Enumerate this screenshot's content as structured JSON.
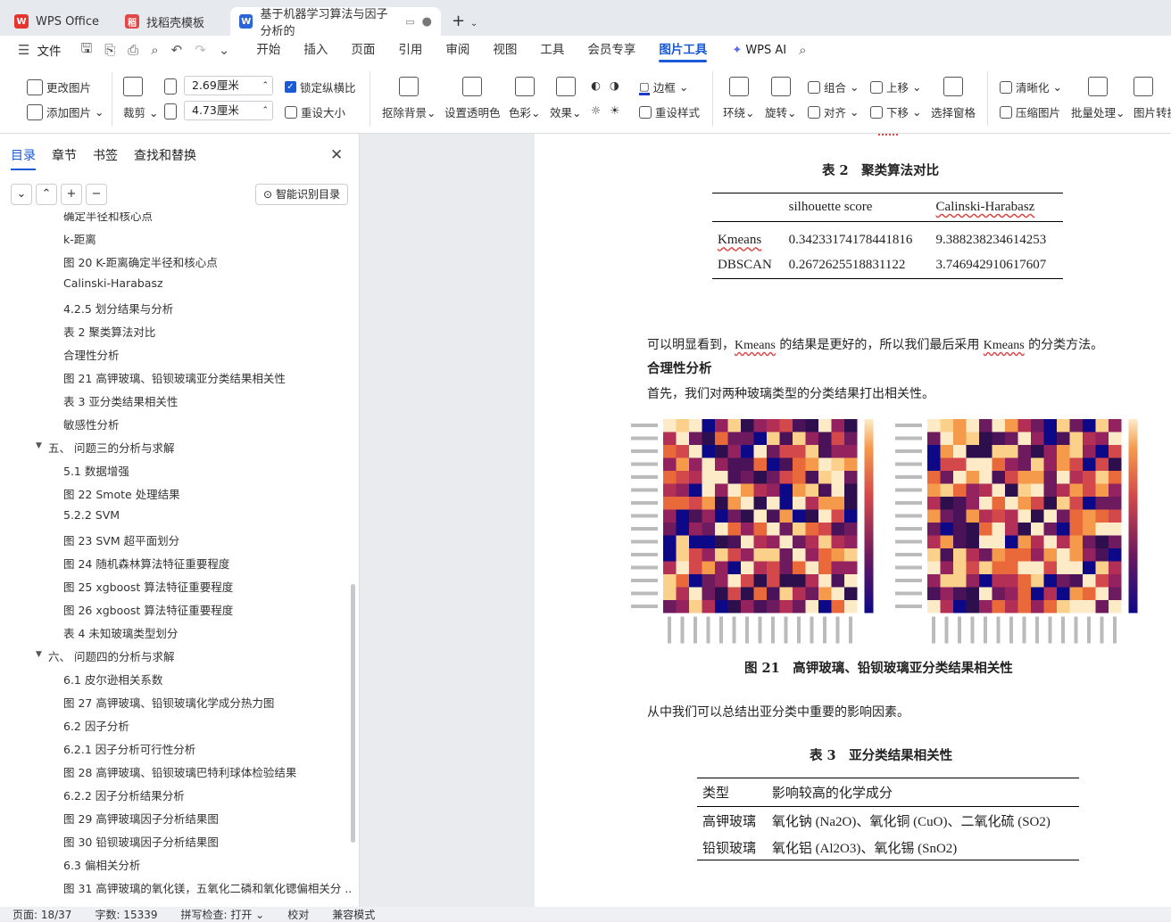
{
  "tabs": [
    {
      "label": "WPS Office",
      "icon": "wps-logo-icon"
    },
    {
      "label": "找稻壳模板",
      "icon": "docer-icon"
    },
    {
      "label": "基于机器学习算法与因子分析的",
      "icon": "word-doc-icon"
    }
  ],
  "menu": {
    "file": "文件",
    "items": [
      "开始",
      "插入",
      "页面",
      "引用",
      "审阅",
      "视图",
      "工具",
      "会员专享",
      "图片工具"
    ],
    "ai": "WPS AI"
  },
  "ribbon": {
    "change_pic": "更改图片",
    "add_pic": "添加图片",
    "crop": "裁剪",
    "height_val": "2.69厘米",
    "width_val": "4.73厘米",
    "lock_ratio": "锁定纵横比",
    "resize": "重设大小",
    "remove_bg": "抠除背景",
    "set_transparent": "设置透明色",
    "color": "色彩",
    "effect": "效果",
    "border": "边框",
    "reset_style": "重设样式",
    "wrap": "环绕",
    "rotate": "旋转",
    "group": "组合",
    "align": "对齐",
    "up": "上移",
    "down": "下移",
    "select_pane": "选择窗格",
    "sharpen": "清晰化",
    "compress": "压缩图片",
    "batch": "批量处理",
    "convert": "图片转换"
  },
  "sidebar": {
    "tabs": [
      "目录",
      "章节",
      "书签",
      "查找和替换"
    ],
    "smart_btn": "智能识别目录",
    "toc": [
      {
        "t": "确定半径和核心点",
        "l": 2
      },
      {
        "t": "k-距离",
        "l": 2
      },
      {
        "t": "图 20 K-距离确定半径和核心点",
        "l": 2
      },
      {
        "t": "Calinski-Harabasz",
        "l": 2
      },
      {
        "t": "4.2.5 划分结果与分析",
        "l": 2
      },
      {
        "t": "表 2 聚类算法对比",
        "l": 2
      },
      {
        "t": "合理性分析",
        "l": 2
      },
      {
        "t": "图 21 高钾玻璃、铅钡玻璃亚分类结果相关性",
        "l": 2
      },
      {
        "t": "表 3 亚分类结果相关性",
        "l": 2
      },
      {
        "t": "敏感性分析",
        "l": 2
      },
      {
        "t": "五、 问题三的分析与求解",
        "l": 1
      },
      {
        "t": "5.1 数据增强",
        "l": 2
      },
      {
        "t": "图 22 Smote 处理结果",
        "l": 2
      },
      {
        "t": "5.2.2 SVM",
        "l": 2
      },
      {
        "t": "图 23 SVM 超平面划分",
        "l": 2
      },
      {
        "t": "图 24 随机森林算法特征重要程度",
        "l": 2
      },
      {
        "t": "图 25 xgboost 算法特征重要程度",
        "l": 2
      },
      {
        "t": "图 26 xgboost 算法特征重要程度",
        "l": 2
      },
      {
        "t": "表 4 未知玻璃类型划分",
        "l": 2
      },
      {
        "t": "六、 问题四的分析与求解",
        "l": 1
      },
      {
        "t": "6.1 皮尔逊相关系数",
        "l": 2
      },
      {
        "t": "图 27 高钾玻璃、铅钡玻璃化学成分热力图",
        "l": 2
      },
      {
        "t": "6.2 因子分析",
        "l": 2
      },
      {
        "t": "6.2.1 因子分析可行性分析",
        "l": 2
      },
      {
        "t": "图 28 高钾玻璃、铅钡玻璃巴特利球体检验结果",
        "l": 2
      },
      {
        "t": "6.2.2 因子分析结果分析",
        "l": 2
      },
      {
        "t": "图 29 高钾玻璃因子分析结果图",
        "l": 2
      },
      {
        "t": "图 30 铅钡玻璃因子分析结果图",
        "l": 2
      },
      {
        "t": "6.3 偏相关分析",
        "l": 2
      },
      {
        "t": "图 31 高钾玻璃的氧化镁，五氧化二磷和氧化锶偏相关分 ...",
        "l": 2
      }
    ]
  },
  "doc": {
    "table2_caption": "表 2　聚类算法对比",
    "table2": {
      "head": [
        "",
        "silhouette score",
        "Calinski-Harabasz"
      ],
      "rows": [
        [
          "Kmeans",
          "0.34233174178441816",
          "9.388238234614253"
        ],
        [
          "DBSCAN",
          "0.2672625518831122",
          "3.746942910617607"
        ]
      ]
    },
    "p1a": "可以明显看到，",
    "p1b": "Kmeans",
    "p1c": " 的结果是更好的，所以我们最后采用 ",
    "p1d": "Kmeans",
    "p1e": " 的分类方法。",
    "h1": "合理性分析",
    "p2": "首先，我们对两种玻璃类型的分类结果打出相关性。",
    "fig21": "图 21　高钾玻璃、铅钡玻璃亚分类结果相关性",
    "p3": "从中我们可以总结出亚分类中重要的影响因素。",
    "table3_caption": "表 3　亚分类结果相关性",
    "table3": {
      "head": [
        "类型",
        "影响较高的化学成分"
      ],
      "rows": [
        [
          "高钾玻璃",
          "氧化钠 (Na2O)、氧化铜 (CuO)、二氧化硫 (SO2)"
        ],
        [
          "铅钡玻璃",
          "氧化铝 (Al2O3)、氧化锡 (SnO2)"
        ]
      ]
    }
  },
  "status": {
    "page": "页面: 18/37",
    "words": "字数: 15339",
    "spell": "拼写检查: 打开",
    "proof": "校对",
    "compat": "兼容模式"
  }
}
